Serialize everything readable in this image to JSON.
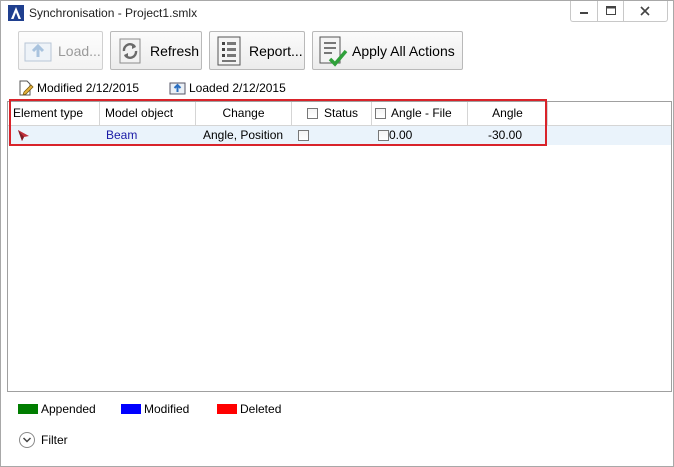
{
  "window": {
    "title": "Synchronisation - Project1.smlx",
    "icons": {
      "app": "app-logo-icon",
      "minimize": "minimize-icon",
      "maximize": "maximize-icon",
      "close": "close-icon"
    }
  },
  "toolbar": {
    "load": {
      "label": "Load...",
      "icon": "load-icon",
      "enabled": false
    },
    "refresh": {
      "label": "Refresh",
      "icon": "refresh-icon"
    },
    "report": {
      "label": "Report...",
      "icon": "report-icon"
    },
    "apply": {
      "label": "Apply All Actions",
      "icon": "apply-actions-icon"
    }
  },
  "info": {
    "modified": "Modified 2/12/2015",
    "loaded": "Loaded 2/12/2015"
  },
  "grid": {
    "columns": {
      "element_type": "Element type",
      "model_object": "Model object",
      "change": "Change",
      "status": "Status",
      "angle_file": "Angle - File",
      "angle": "Angle"
    },
    "rows": [
      {
        "element_type_icon": "beam-arrow-icon",
        "model_object": "Beam",
        "change": "Angle, Position",
        "status_checked": false,
        "angle_file_checked": false,
        "angle_file": "0.00",
        "angle": "-30.00"
      }
    ]
  },
  "legend": {
    "appended": {
      "label": "Appended",
      "color": "#007d00"
    },
    "modified": {
      "label": "Modified",
      "color": "#0000ff"
    },
    "deleted": {
      "label": "Deleted",
      "color": "#ff0000"
    }
  },
  "filter": {
    "label": "Filter",
    "icon": "chevron-down-icon"
  },
  "colors": {
    "highlight": "#d9232a",
    "link": "#1a1aa6",
    "row_selected": "#eaf3fb"
  }
}
